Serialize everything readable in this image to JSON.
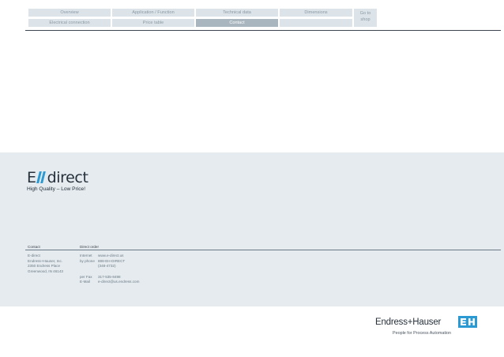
{
  "nav": {
    "row1": [
      "Overview",
      "Application / Function",
      "Technical data",
      "Dimensions"
    ],
    "row2": [
      "Electrical connection",
      "Price table",
      "Contact",
      ""
    ],
    "shop_line1": "Go to",
    "shop_line2": "shop",
    "active_tab": "Contact"
  },
  "brand": {
    "logo_left": "E",
    "logo_right": "direct",
    "tagline": "High Quality – Low Price!"
  },
  "contact": {
    "heading_contact": "Contact",
    "heading_order": "Direct order",
    "address": [
      "E-direct",
      "Endress+Hauser, Inc.",
      "2350 Endress Place",
      "Greenwood, IN 46143"
    ],
    "order_labels": [
      "Internet",
      "by phone",
      "",
      "",
      "per Fax",
      "E-Mail"
    ],
    "order_values": [
      "www.e-direct.us",
      "888-EH-DIRECT",
      "(348-4732)",
      "",
      "317-535-8498",
      "e-direct@us.endress.com"
    ]
  },
  "footer": {
    "company": "Endress+Hauser",
    "slogan": "People for Process Automation"
  },
  "colors": {
    "accent": "#2b9ad3",
    "panel": "#e5ebee",
    "tab": "#dde4e9",
    "tab_active": "#a9b6bf"
  }
}
